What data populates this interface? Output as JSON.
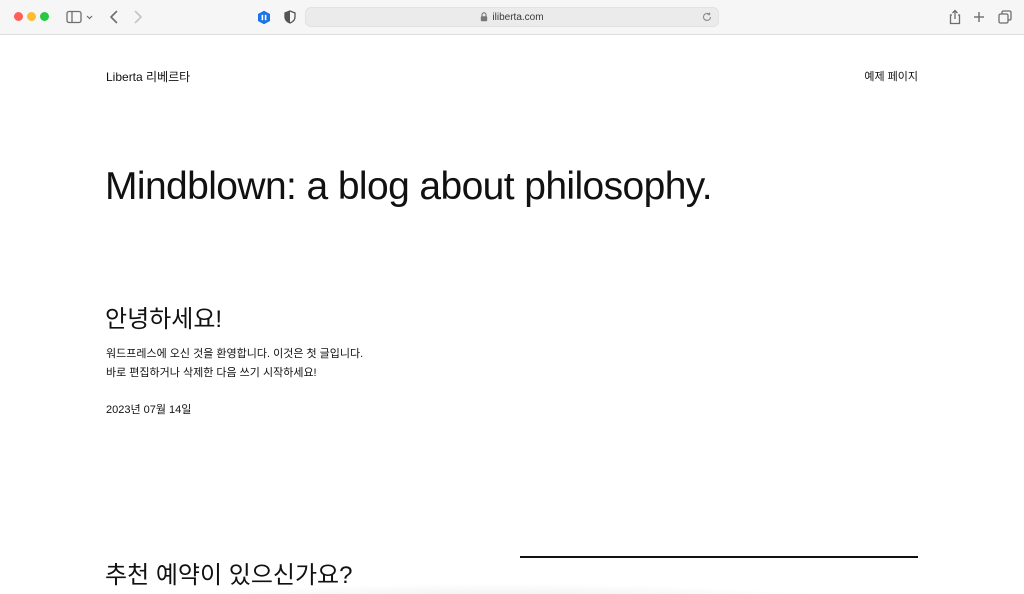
{
  "browser": {
    "url": "iliberta.com",
    "icons": {
      "sidebar": "sidebar-icon",
      "back": "chevron-left-icon",
      "forward": "chevron-right-icon",
      "extension": "extension-icon",
      "privacy": "shield-icon",
      "lock": "lock-icon",
      "reload": "reload-icon",
      "share": "share-icon",
      "new_tab": "plus-icon",
      "tabs": "tab-overview-icon"
    },
    "colors": {
      "close": "#ff5f57",
      "minimize": "#febc2e",
      "zoom": "#28c840",
      "extension": "#1a73e8"
    }
  },
  "header": {
    "site_title": "Liberta 리베르타",
    "nav_link": "예제 페이지"
  },
  "hero": {
    "title": "Mindblown: a blog about philosophy."
  },
  "post": {
    "title": "안녕하세요!",
    "excerpt": "워드프레스에 오신 것을 환영합니다. 이것은 첫 글입니다. 바로 편집하거나 삭제한 다음 쓰기 시작하세요!",
    "date": "2023년 07월 14일"
  },
  "recommendation": {
    "title": "추천 예약이 있으신가요?"
  }
}
